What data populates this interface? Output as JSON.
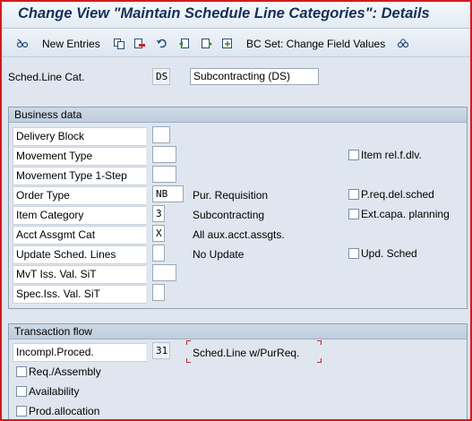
{
  "window": {
    "title": "Change View \"Maintain Schedule Line Categories\": Details"
  },
  "toolbar": {
    "new_entries_label": "New Entries",
    "bc_set_label": "BC Set: Change Field Values"
  },
  "header": {
    "sched_line_cat_label": "Sched.Line Cat.",
    "sched_line_cat_value": "DS",
    "sched_line_cat_desc": "Subcontracting (DS)"
  },
  "business_data": {
    "title": "Business data",
    "delivery_block_label": "Delivery Block",
    "delivery_block_value": "",
    "movement_type_label": "Movement Type",
    "movement_type_value": "",
    "movement_type_1step_label": "Movement Type 1-Step",
    "movement_type_1step_value": "",
    "order_type_label": "Order Type",
    "order_type_value": "NB",
    "order_type_desc": "Pur. Requisition",
    "item_category_label": "Item Category",
    "item_category_value": "3",
    "item_category_desc": "Subcontracting",
    "acct_assgmt_cat_label": "Acct Assgmt Cat",
    "acct_assgmt_cat_value": "X",
    "acct_assgmt_cat_desc": "All aux.acct.assgts.",
    "update_sched_lines_label": "Update Sched. Lines",
    "update_sched_lines_value": "",
    "update_sched_lines_desc": "No Update",
    "mvt_iss_val_sit_label": "MvT Iss. Val. SiT",
    "mvt_iss_val_sit_value": "",
    "spec_iss_val_sit_label": "Spec.Iss. Val. SiT",
    "spec_iss_val_sit_value": "",
    "item_rel_dlv_label": "Item rel.f.dlv.",
    "item_rel_dlv_checked": false,
    "preq_del_sched_label": "P.req.del.sched",
    "preq_del_sched_checked": false,
    "ext_capa_planning_label": "Ext.capa. planning",
    "ext_capa_planning_checked": false,
    "upd_sched_label": "Upd. Sched",
    "upd_sched_checked": false
  },
  "transaction_flow": {
    "title": "Transaction flow",
    "incompl_proced_label": "Incompl.Proced.",
    "incompl_proced_value": "31",
    "incompl_proced_desc": "Sched.Line w/PurReq.",
    "req_assembly_label": "Req./Assembly",
    "req_assembly_checked": false,
    "availability_label": "Availability",
    "availability_checked": false,
    "prod_allocation_label": "Prod.allocation",
    "prod_allocation_checked": false
  },
  "icons": [
    "glasses-edit-icon",
    "copy-icon",
    "delete-icon",
    "undo-icon",
    "previous-entry-icon",
    "next-entry-icon",
    "export-icon",
    "bc-set-icon"
  ],
  "colors": {
    "frame_border": "#d7191c",
    "title_text": "#14305a",
    "background": "#dfe6ef"
  }
}
